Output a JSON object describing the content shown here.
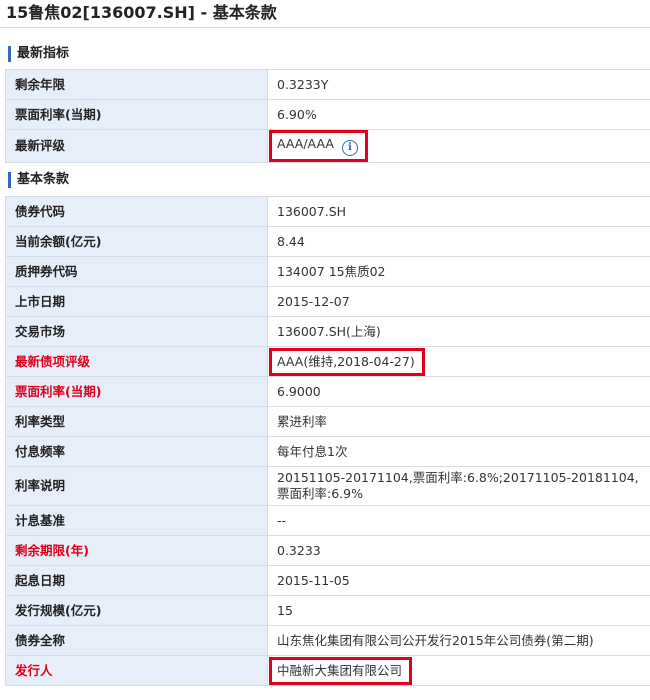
{
  "page": {
    "title": "15鲁焦02[136007.SH] - 基本条款"
  },
  "sections": {
    "latest": {
      "title": "最新指标",
      "rows": [
        {
          "label": "剩余年限",
          "value": "0.3233Y"
        },
        {
          "label": "票面利率(当期)",
          "value": "6.90%"
        },
        {
          "label": "最新评级",
          "value": "AAA/AAA"
        }
      ]
    },
    "basic": {
      "title": "基本条款",
      "rows": [
        {
          "label": "债券代码",
          "value": "136007.SH"
        },
        {
          "label": "当前余额(亿元)",
          "value": "8.44"
        },
        {
          "label": "质押券代码",
          "value": "134007 15焦质02"
        },
        {
          "label": "上市日期",
          "value": "2015-12-07"
        },
        {
          "label": "交易市场",
          "value": "136007.SH(上海)"
        },
        {
          "label": "最新债项评级",
          "value": "AAA(维持,2018-04-27)"
        },
        {
          "label": "票面利率(当期)",
          "value": "6.9000"
        },
        {
          "label": "利率类型",
          "value": "累进利率"
        },
        {
          "label": "付息频率",
          "value": "每年付息1次"
        },
        {
          "label": "利率说明",
          "value": "20151105-20171104,票面利率:6.8%;20171105-20181104,票面利率:6.9%"
        },
        {
          "label": "计息基准",
          "value": "--"
        },
        {
          "label": "剩余期限(年)",
          "value": "0.3233"
        },
        {
          "label": "起息日期",
          "value": "2015-11-05"
        },
        {
          "label": "发行规模(亿元)",
          "value": "15"
        },
        {
          "label": "债券全称",
          "value": "山东焦化集团有限公司公开发行2015年公司债券(第二期)"
        },
        {
          "label": "发行人",
          "value": "中融新大集团有限公司"
        }
      ]
    }
  },
  "icons": {
    "rating_info": "info-icon"
  },
  "colors": {
    "highlight": "#e0001b",
    "label_bg": "#e6eefa",
    "accent": "#2f6cc0"
  }
}
